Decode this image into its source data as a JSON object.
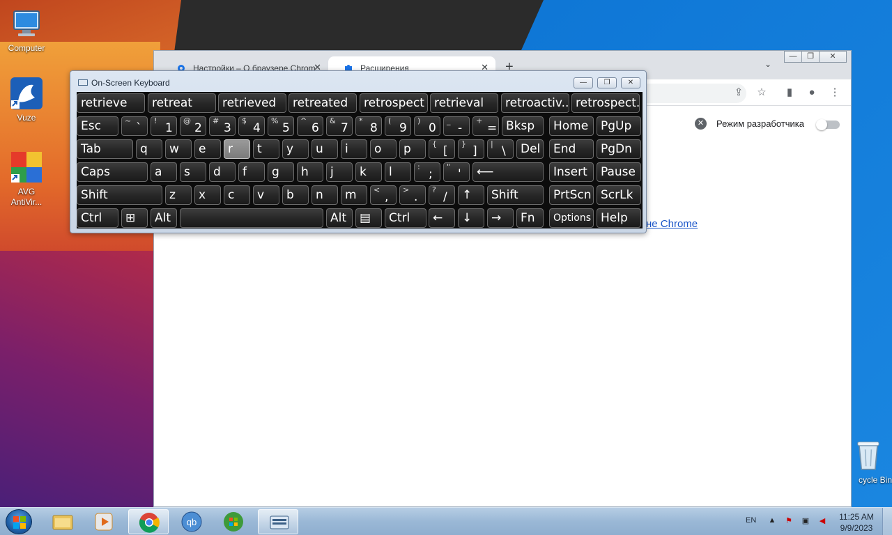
{
  "desktop": {
    "icons": [
      {
        "label": "Computer",
        "icon": "computer-icon"
      },
      {
        "label": "Vuze",
        "icon": "vuze-frog-icon"
      },
      {
        "label_line1": "AVG",
        "label_line2": "AntiVir...",
        "icon": "avg-antivirus-icon"
      },
      {
        "label": "cycle Bin",
        "icon": "recycle-bin-icon"
      }
    ]
  },
  "chrome": {
    "tabs": [
      {
        "title": "Настройки – О браузере Chrom",
        "icon": "settings-gear-icon"
      },
      {
        "title": "Расширения",
        "icon": "puzzle-icon"
      }
    ],
    "new_tab": "+",
    "tab_search": "⌄",
    "window_controls": {
      "minimize": "—",
      "restore": "❐",
      "close": "✕"
    },
    "dev_mode_label": "Режим разработчика",
    "dev_mode_enabled": false,
    "link_text": "не Chrome"
  },
  "osk": {
    "title": "On-Screen Keyboard",
    "controls": {
      "minimize": "—",
      "restore": "❐",
      "close": "✕"
    },
    "suggestions": [
      "retrieve",
      "retreat",
      "retrieved",
      "retreated",
      "retrospect",
      "retrieval",
      "retroactiv...",
      "retrospect..."
    ],
    "row1": [
      {
        "l": "Esc"
      },
      {
        "s": "~",
        "m": "`"
      },
      {
        "s": "!",
        "m": "1"
      },
      {
        "s": "@",
        "m": "2"
      },
      {
        "s": "#",
        "m": "3"
      },
      {
        "s": "$",
        "m": "4"
      },
      {
        "s": "%",
        "m": "5"
      },
      {
        "s": "^",
        "m": "6"
      },
      {
        "s": "&",
        "m": "7"
      },
      {
        "s": "*",
        "m": "8"
      },
      {
        "s": "(",
        "m": "9"
      },
      {
        "s": ")",
        "m": "0"
      },
      {
        "s": "_",
        "m": "-"
      },
      {
        "s": "+",
        "m": "="
      },
      {
        "l": "Bksp"
      },
      {
        "l": "Home"
      },
      {
        "l": "PgUp"
      }
    ],
    "row2": [
      {
        "l": "Tab"
      },
      {
        "l": "q"
      },
      {
        "l": "w"
      },
      {
        "l": "e"
      },
      {
        "l": "r"
      },
      {
        "l": "t"
      },
      {
        "l": "y"
      },
      {
        "l": "u"
      },
      {
        "l": "i"
      },
      {
        "l": "o"
      },
      {
        "l": "p"
      },
      {
        "s": "{",
        "m": "["
      },
      {
        "s": "}",
        "m": "]"
      },
      {
        "s": "|",
        "m": "\\"
      },
      {
        "l": "Del"
      },
      {
        "l": "End"
      },
      {
        "l": "PgDn"
      }
    ],
    "row3": [
      {
        "l": "Caps"
      },
      {
        "l": "a"
      },
      {
        "l": "s"
      },
      {
        "l": "d"
      },
      {
        "l": "f"
      },
      {
        "l": "g"
      },
      {
        "l": "h"
      },
      {
        "l": "j"
      },
      {
        "l": "k"
      },
      {
        "l": "l"
      },
      {
        "s": ":",
        "m": ";"
      },
      {
        "s": "\"",
        "m": "'"
      },
      {
        "l": "⟵"
      },
      {
        "l": "Insert"
      },
      {
        "l": "Pause"
      }
    ],
    "row4": [
      {
        "l": "Shift"
      },
      {
        "l": "z"
      },
      {
        "l": "x"
      },
      {
        "l": "c"
      },
      {
        "l": "v"
      },
      {
        "l": "b"
      },
      {
        "l": "n"
      },
      {
        "l": "m"
      },
      {
        "s": "<",
        "m": ","
      },
      {
        "s": ">",
        "m": "."
      },
      {
        "s": "?",
        "m": "/"
      },
      {
        "l": "↑"
      },
      {
        "l": "Shift"
      },
      {
        "l": "PrtScn"
      },
      {
        "l": "ScrLk"
      }
    ],
    "row5": [
      {
        "l": "Ctrl"
      },
      {
        "l": "⊞"
      },
      {
        "l": "Alt"
      },
      {
        "l": ""
      },
      {
        "l": "Alt"
      },
      {
        "l": "▤"
      },
      {
        "l": "Ctrl"
      },
      {
        "l": "←"
      },
      {
        "l": "↓"
      },
      {
        "l": "→"
      },
      {
        "l": "Fn"
      },
      {
        "l": "Options"
      },
      {
        "l": "Help"
      }
    ],
    "hovered_key": "r"
  },
  "taskbar": {
    "apps": [
      "file-explorer-icon",
      "media-player-icon",
      "chrome-icon",
      "qbittorrent-icon",
      "windows-update-icon",
      "on-screen-keyboard-icon"
    ],
    "qb_label": "qb",
    "lang": "EN",
    "time": "11:25 AM",
    "date": "9/9/2023"
  }
}
